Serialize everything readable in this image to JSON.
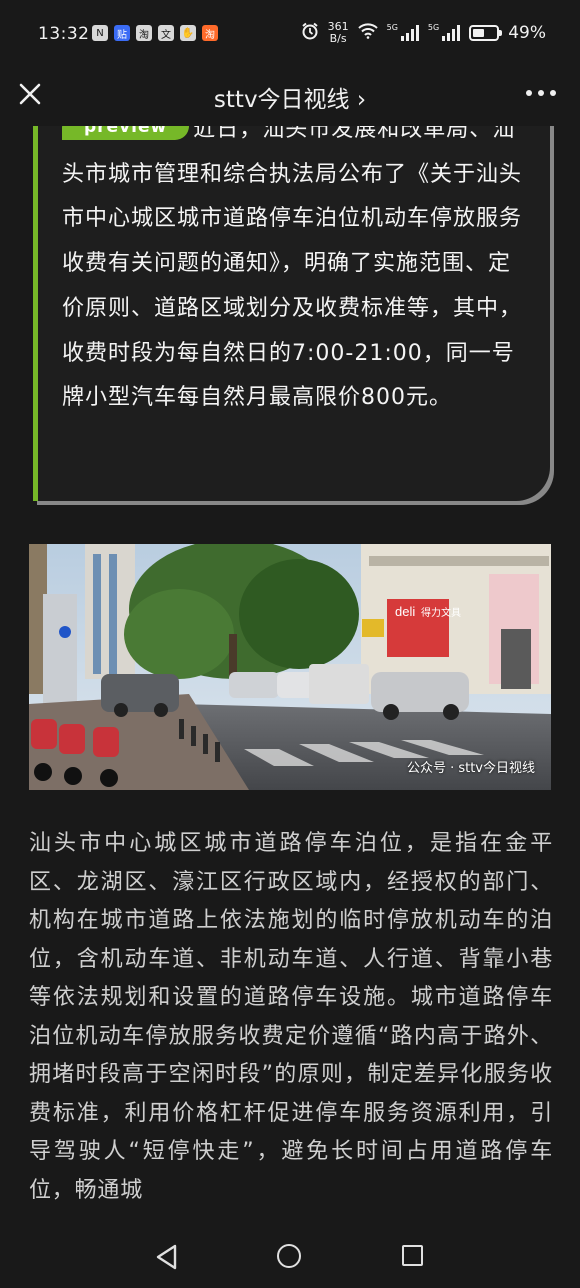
{
  "status_bar": {
    "time": "13:32",
    "net_speed_value": "361",
    "net_speed_unit": "B/s",
    "network": "5G",
    "battery": "49%",
    "battery_level": 0.49
  },
  "nav": {
    "title": "sttv今日视线 ›"
  },
  "card": {
    "badge": "preview",
    "text": "近日，汕头市发展和改革局、汕头市城市管理和综合执法局公布了《关于汕头市中心城区城市道路停车泊位机动车停放服务收费有关问题的通知》，明确了实施范围、定价原则、道路区域划分及收费标准等，其中，收费时段为每自然日的7:00-21:00，同一号牌小型汽车每自然月最高限价800元。"
  },
  "photo": {
    "watermark": "公众号 · sttv今日视线",
    "signs": [
      "deli",
      "得力文具",
      "文具"
    ]
  },
  "article": {
    "paragraph": "汕头市中心城区城市道路停车泊位，是指在金平区、龙湖区、濠江区行政区域内，经授权的部门、机构在城市道路上依法施划的临时停放机动车的泊位，含机动车道、非机动车道、人行道、背靠小巷等依法规划和设置的道路停车设施。城市道路停车泊位机动车停放服务收费定价遵循“路内高于路外、拥堵时段高于空闲时段”的原则，制定差异化服务收费标准，利用价格杠杆促进停车服务资源利用，引导驾驶人“短停快走”，避免长时间占用道路停车位，畅通城"
  },
  "colors": {
    "background": "#191919",
    "accent": "#76b828",
    "card_text": "#f4f4f4",
    "body_text": "#cfcfcf"
  }
}
